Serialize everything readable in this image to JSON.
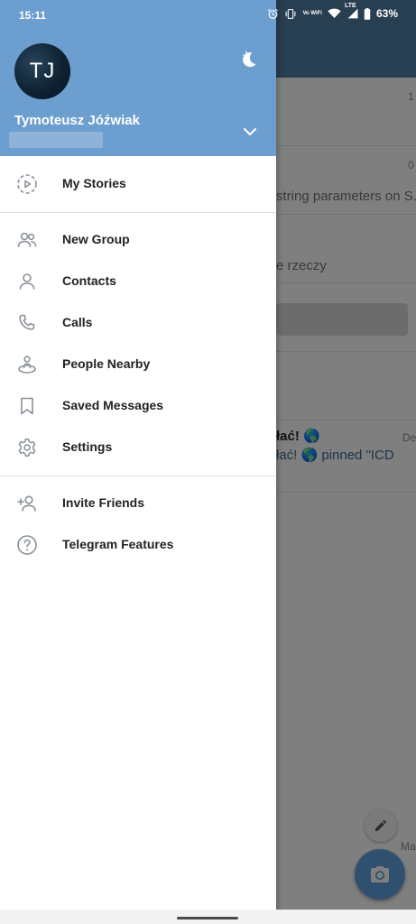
{
  "status_bar": {
    "time": "15:11",
    "battery": "63%",
    "network": "LTE",
    "wifi_label": "Vo WiFi",
    "icons": [
      "alarm-icon",
      "vibrate-icon",
      "vowifi-icon",
      "wifi-icon",
      "signal-icon",
      "battery-icon"
    ]
  },
  "background_chats": {
    "snippets": [
      "1",
      "0",
      "string parameters on S...",
      "e rzeczy",
      "łać! 🌎",
      "łać! 🌎 pinned \"ICD",
      "De",
      "Ma"
    ]
  },
  "drawer": {
    "header": {
      "avatar_initials": "TJ",
      "name": "Tymoteusz Jóźwiak",
      "night_mode_icon": "moon-icon",
      "expand_icon": "chevron-down-icon"
    },
    "menu": [
      {
        "label": "My Stories",
        "icon": "stories-icon"
      },
      {
        "label": "New Group",
        "icon": "group-icon"
      },
      {
        "label": "Contacts",
        "icon": "contact-icon"
      },
      {
        "label": "Calls",
        "icon": "phone-icon"
      },
      {
        "label": "People Nearby",
        "icon": "people-nearby-icon"
      },
      {
        "label": "Saved Messages",
        "icon": "bookmark-icon"
      },
      {
        "label": "Settings",
        "icon": "gear-icon"
      },
      {
        "label": "Invite Friends",
        "icon": "add-user-icon"
      },
      {
        "label": "Telegram Features",
        "icon": "help-icon"
      }
    ]
  },
  "colors": {
    "header": "#6c9ecf",
    "app_bar": "#517da2",
    "fab": "#5fa3de",
    "icon": "#8a9099"
  }
}
